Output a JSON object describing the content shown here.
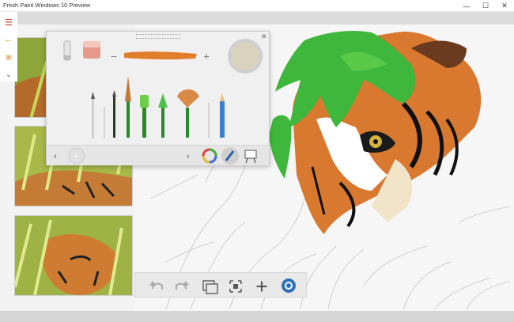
{
  "window": {
    "title": "Fresh Paint Windows 10 Preview",
    "controls": {
      "minimize": "—",
      "maximize": "☐",
      "close": "✕"
    }
  },
  "leftbar": {
    "menu_icon": "hamburger-icon",
    "back_icon": "back-arrow-icon",
    "add_icon": "add-image-icon",
    "more_icon": "chevron-down-icon"
  },
  "thumbnails": [
    {
      "name": "tiger-in-grass-crop"
    },
    {
      "name": "tiger-in-grass"
    },
    {
      "name": "tiger-face-in-grass"
    }
  ],
  "tool_panel": {
    "tools": [
      "pencil-eraser",
      "eraser-block",
      "oil-brush-round",
      "oil-brush-thin",
      "oil-brush-medium",
      "flat-brush-green",
      "round-brush-green",
      "fan-brush",
      "pencil-blue"
    ],
    "brush_size_minus": "−",
    "brush_size_plus": "+",
    "color_swatch": "#d8d2bf",
    "brush_stroke_color": "#e07e2c",
    "footer": {
      "prev_icon": "chevron-left-icon",
      "next_icon": "chevron-right-icon",
      "add_icon": "plus-icon",
      "color_wheel_icon": "color-wheel-icon",
      "brush_mode_icon": "brush-icon",
      "easel_icon": "easel-icon"
    }
  },
  "bottom_toolbar": {
    "undo_icon": "undo-icon",
    "redo_icon": "redo-icon",
    "layers_icon": "layers-icon",
    "fit_icon": "fit-screen-icon",
    "dry_icon": "fan-dry-icon",
    "wet_icon": "wet-canvas-icon"
  },
  "colors": {
    "accent": "#d03a2a",
    "grass_green": "#3fb63c",
    "tiger_orange": "#d9782f",
    "panel_bg": "#f0f0f0"
  }
}
